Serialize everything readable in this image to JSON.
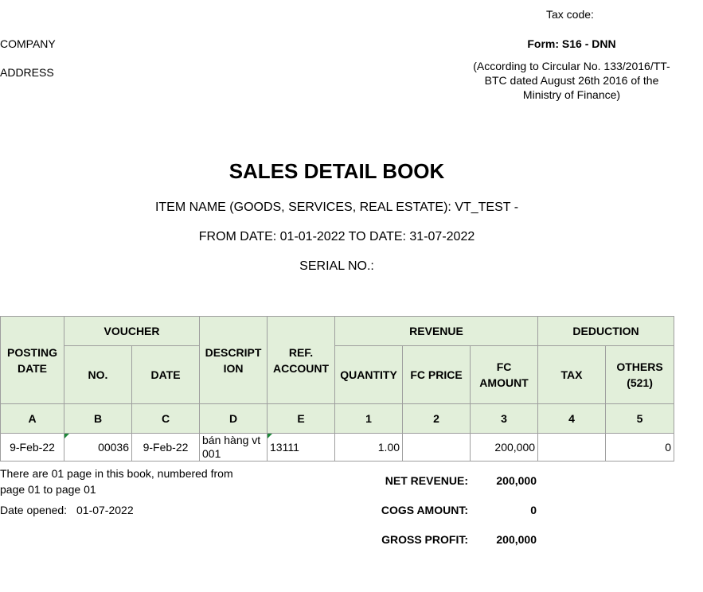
{
  "header": {
    "tax_code_label": "Tax code:",
    "company_label": "COMPANY",
    "address_label": "ADDRESS",
    "form_code": "Form: S16 - DNN",
    "circular_text": "(According to Circular No. 133/2016/TT-BTC dated August 26th 2016 of the Ministry of Finance)"
  },
  "report": {
    "title": "SALES DETAIL BOOK",
    "item_name": "ITEM NAME (GOODS, SERVICES, REAL ESTATE): VT_TEST -",
    "date_range": "FROM DATE: 01-01-2022 TO DATE: 31-07-2022",
    "serial": "SERIAL NO.:"
  },
  "table": {
    "headers": {
      "posting_date": "POSTING DATE",
      "voucher": "VOUCHER",
      "voucher_no": "NO.",
      "voucher_date": "DATE",
      "description": "DESCRIPT ION",
      "ref_account": "REF. ACCOUNT",
      "revenue": "REVENUE",
      "quantity": "QUANTITY",
      "fc_price": "FC PRICE",
      "fc_amount": "FC AMOUNT",
      "deduction": "DEDUCTION",
      "tax": "TAX",
      "others": "OTHERS (521)"
    },
    "codes": [
      "A",
      "B",
      "C",
      "D",
      "E",
      "1",
      "2",
      "3",
      "4",
      "5"
    ],
    "rows": [
      {
        "posting_date": "9-Feb-22",
        "voucher_no": "00036",
        "voucher_date": "9-Feb-22",
        "description": "bán hàng vt 001",
        "ref_account": "13111",
        "quantity": "1.00",
        "fc_price": "",
        "fc_amount": "200,000",
        "tax": "",
        "others": "0"
      }
    ]
  },
  "footer": {
    "pages_note": "There are 01 page in this book, numbered from page 01 to page 01",
    "date_opened_label": "Date opened:",
    "date_opened_value": "01-07-2022"
  },
  "summary": {
    "net_revenue_label": "NET REVENUE:",
    "net_revenue_value": "200,000",
    "cogs_label": "COGS AMOUNT:",
    "cogs_value": "0",
    "gross_profit_label": "GROSS PROFIT:",
    "gross_profit_value": "200,000"
  }
}
